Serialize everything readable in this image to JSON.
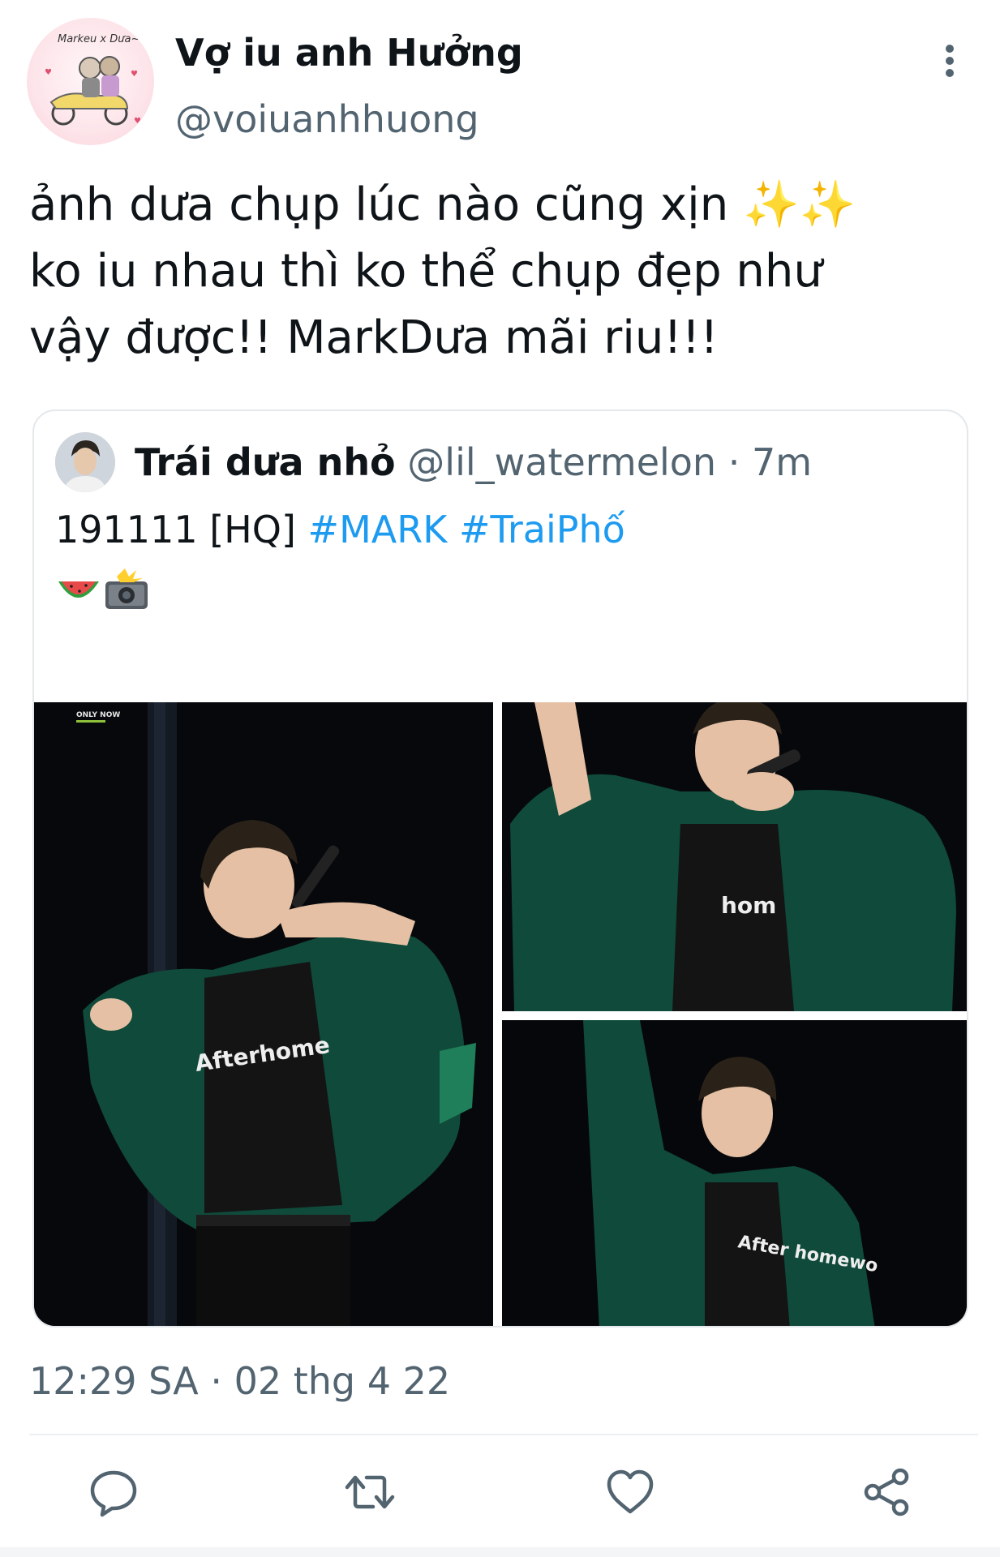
{
  "tweet": {
    "display_name": "Vợ iu anh Hưởng",
    "handle": "@voiuanhhuong",
    "avatar_text": "Markeu x Dưa~~",
    "text_lines": [
      "ảnh dưa chụp lúc nào cũng xịn ✨✨",
      "ko iu nhau thì ko thể chụp đẹp như",
      "vậy được!! MarkDưa mãi riu!!!"
    ],
    "timestamp": "12:29 SA · 02 thg 4 22"
  },
  "quoted": {
    "display_name": "Trái dưa nhỏ",
    "handle": "@lil_watermelon",
    "separator": " · ",
    "time": "7m",
    "text_plain": "191111 [HQ] ",
    "hashtags": [
      "#MARK",
      "#TraiPhố"
    ],
    "emoji_icons": [
      "watermelon-icon",
      "camera-flash-icon"
    ],
    "photos": [
      {
        "name": "concert-photo-1",
        "shirt_text": "Afterhome",
        "watermark": "ONLY NOW"
      },
      {
        "name": "concert-photo-2",
        "shirt_text": "hom"
      },
      {
        "name": "concert-photo-3",
        "shirt_text": "After homewo"
      }
    ]
  },
  "actions": [
    {
      "name": "reply",
      "icon": "reply-icon"
    },
    {
      "name": "retweet",
      "icon": "retweet-icon"
    },
    {
      "name": "like",
      "icon": "heart-icon"
    },
    {
      "name": "share",
      "icon": "share-icon"
    }
  ],
  "colors": {
    "text": "#0f1419",
    "secondary": "#536471",
    "link": "#1d9bf0",
    "border": "#e4e8eb",
    "jacket": "#0f4a3a"
  }
}
